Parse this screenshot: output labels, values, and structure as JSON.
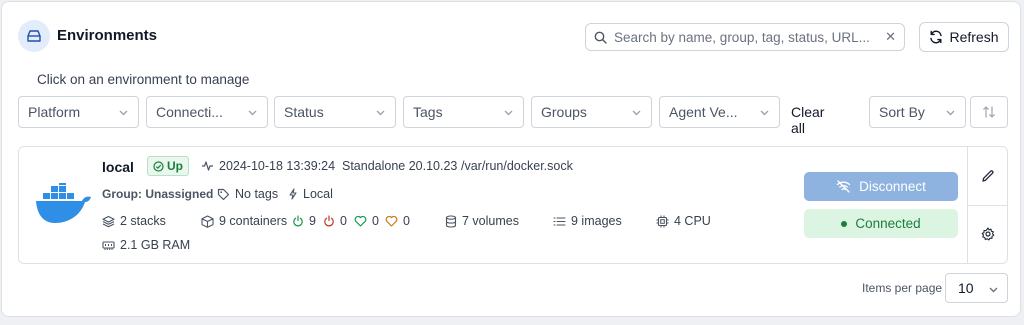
{
  "header": {
    "title": "Environments",
    "subtitle": "Click on an environment to manage"
  },
  "search": {
    "placeholder": "Search by name, group, tag, status, URL..."
  },
  "toolbar": {
    "refresh_label": "Refresh",
    "clear_all_label": "Clear all"
  },
  "filters": [
    "Platform",
    "Connecti...",
    "Status",
    "Tags",
    "Groups",
    "Agent Ve..."
  ],
  "sort": {
    "label": "Sort By"
  },
  "environment": {
    "name": "local",
    "status": "Up",
    "last_check": "2024-10-18 13:39:24",
    "engine": "Standalone 20.10.23",
    "url": "/var/run/docker.sock",
    "group_label": "Group: Unassigned",
    "tags": "No tags",
    "type": "Local",
    "stacks": "2 stacks",
    "containers": "9 containers",
    "running": "9",
    "stopped": "0",
    "healthy": "0",
    "unhealthy": "0",
    "volumes": "7 volumes",
    "images": "9 images",
    "cpu": "4 CPU",
    "ram": "2.1 GB RAM",
    "disconnect_label": "Disconnect",
    "connected_label": "Connected"
  },
  "pagination": {
    "items_per_page_label": "Items per page",
    "items_per_page_value": "10"
  },
  "colors": {
    "accent": "#8fb3e0",
    "success": "#1b7f3b",
    "docker_blue": "#2f8fe6"
  }
}
